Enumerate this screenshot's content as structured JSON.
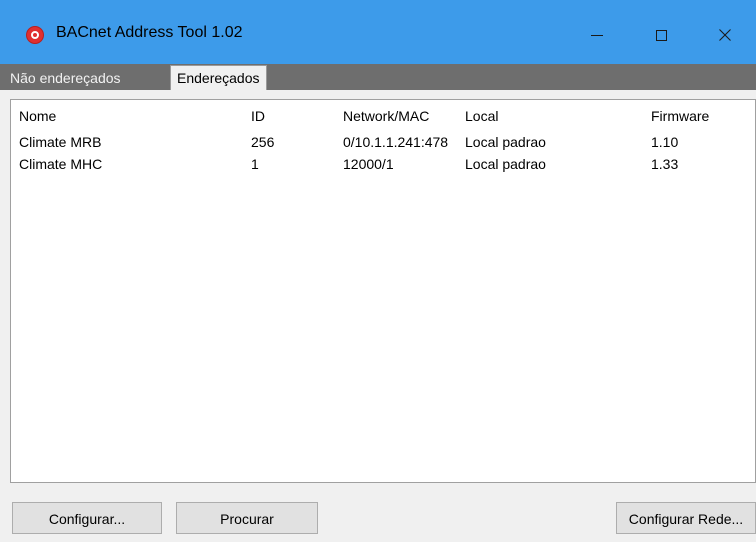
{
  "window": {
    "title": "BACnet Address Tool 1.02",
    "minimize_glyph": "—",
    "maximize_glyph": "☐",
    "close_glyph": "✕"
  },
  "tabs": [
    {
      "label": "Não endereçados",
      "active": false
    },
    {
      "label": "Endereçados",
      "active": true
    }
  ],
  "table": {
    "columns": [
      "Nome",
      "ID",
      "Network/MAC",
      "Local",
      "Firmware"
    ],
    "rows": [
      {
        "nome": "Climate MRB",
        "id": "256",
        "network_mac": "0/10.1.1.241:478",
        "local": "Local padrao",
        "firmware": "1.10"
      },
      {
        "nome": "Climate MHC",
        "id": "1",
        "network_mac": "12000/1",
        "local": "Local padrao",
        "firmware": "1.33"
      }
    ]
  },
  "buttons": {
    "configurar": "Configurar...",
    "procurar": "Procurar",
    "configurar_rede": "Configurar Rede..."
  },
  "colors": {
    "titlebar": "#3d9bea",
    "tabbar": "#6e6e6e",
    "app_icon": "#e03030"
  },
  "icons": {
    "app": "bacnet-app-icon",
    "minimize": "minimize-icon",
    "maximize": "maximize-icon",
    "close": "close-icon"
  }
}
